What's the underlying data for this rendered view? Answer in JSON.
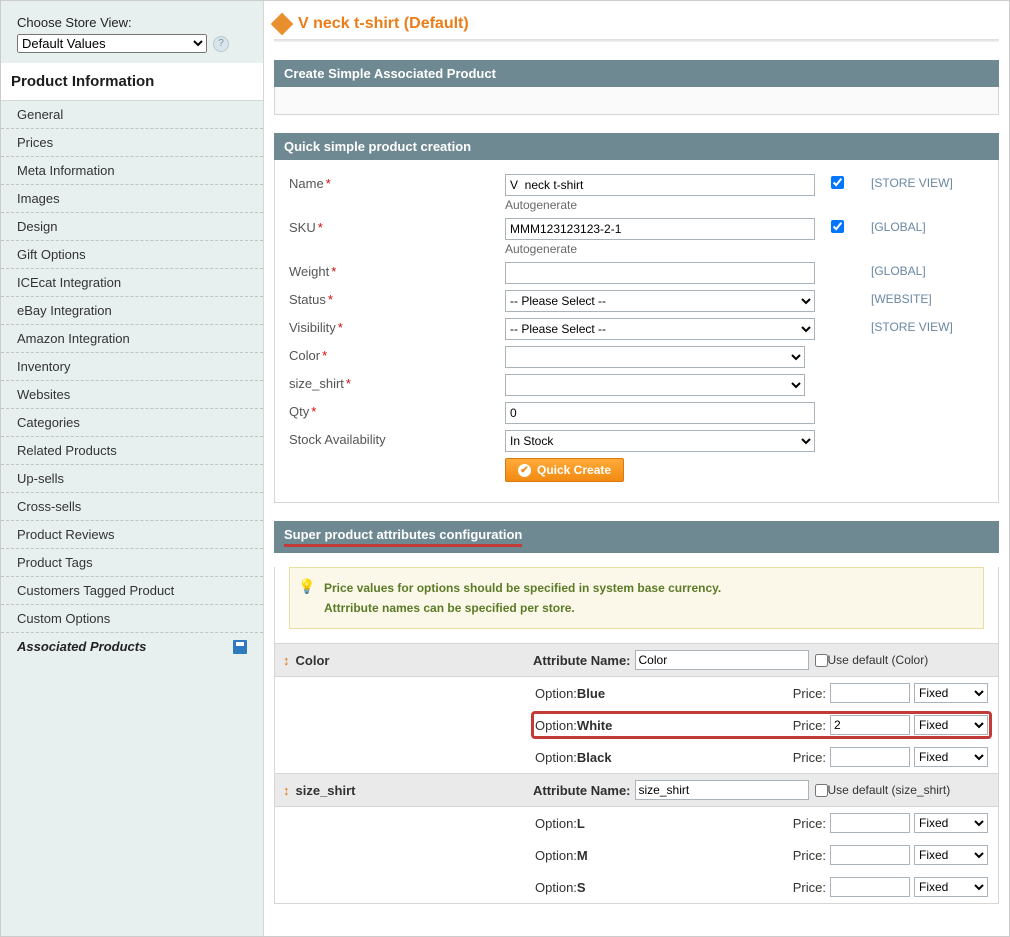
{
  "store_view": {
    "label": "Choose Store View:",
    "selected": "Default Values"
  },
  "sidebar": {
    "section_title": "Product Information",
    "tabs": [
      "General",
      "Prices",
      "Meta Information",
      "Images",
      "Design",
      "Gift Options",
      "ICEcat Integration",
      "eBay Integration",
      "Amazon Integration",
      "Inventory",
      "Websites",
      "Categories",
      "Related Products",
      "Up-sells",
      "Cross-sells",
      "Product Reviews",
      "Product Tags",
      "Customers Tagged Product",
      "Custom Options",
      "Associated Products"
    ]
  },
  "page_title": "V neck t-shirt (Default)",
  "panels": {
    "create_simple": "Create Simple Associated Product",
    "quick_create": "Quick simple product creation",
    "super_attrs": "Super product attributes configuration"
  },
  "form": {
    "name": {
      "label": "Name",
      "value": "V  neck t-shirt",
      "sub": "Autogenerate",
      "scope": "[STORE VIEW]"
    },
    "sku": {
      "label": "SKU",
      "value": "MMM123123123-2-1",
      "sub": "Autogenerate",
      "scope": "[GLOBAL]"
    },
    "weight": {
      "label": "Weight",
      "value": "",
      "scope": "[GLOBAL]"
    },
    "status": {
      "label": "Status",
      "selected": "-- Please Select --",
      "scope": "[WEBSITE]"
    },
    "visibility": {
      "label": "Visibility",
      "selected": "-- Please Select --",
      "scope": "[STORE VIEW]"
    },
    "color": {
      "label": "Color",
      "selected": ""
    },
    "size_shirt": {
      "label": "size_shirt",
      "selected": ""
    },
    "qty": {
      "label": "Qty",
      "value": "0"
    },
    "stock": {
      "label": "Stock Availability",
      "selected": "In Stock"
    },
    "button": "Quick Create"
  },
  "note": {
    "line1": "Price values for options should be specified in system base currency.",
    "line2": "Attrribute names can be specified per store."
  },
  "attrs": {
    "name_label": "Attribute Name:",
    "use_default_prefix": "Use default",
    "option_prefix": "Option:",
    "price_prefix": "Price:",
    "fixed": "Fixed",
    "groups": [
      {
        "title": "Color",
        "attr_name": "Color",
        "use_default_suffix": "(Color)",
        "options": [
          {
            "name": "Blue",
            "price": ""
          },
          {
            "name": "White",
            "price": "2",
            "highlight": true
          },
          {
            "name": "Black",
            "price": ""
          }
        ]
      },
      {
        "title": "size_shirt",
        "attr_name": "size_shirt",
        "use_default_suffix": "(size_shirt)",
        "options": [
          {
            "name": "L",
            "price": ""
          },
          {
            "name": "M",
            "price": ""
          },
          {
            "name": "S",
            "price": ""
          }
        ]
      }
    ]
  }
}
